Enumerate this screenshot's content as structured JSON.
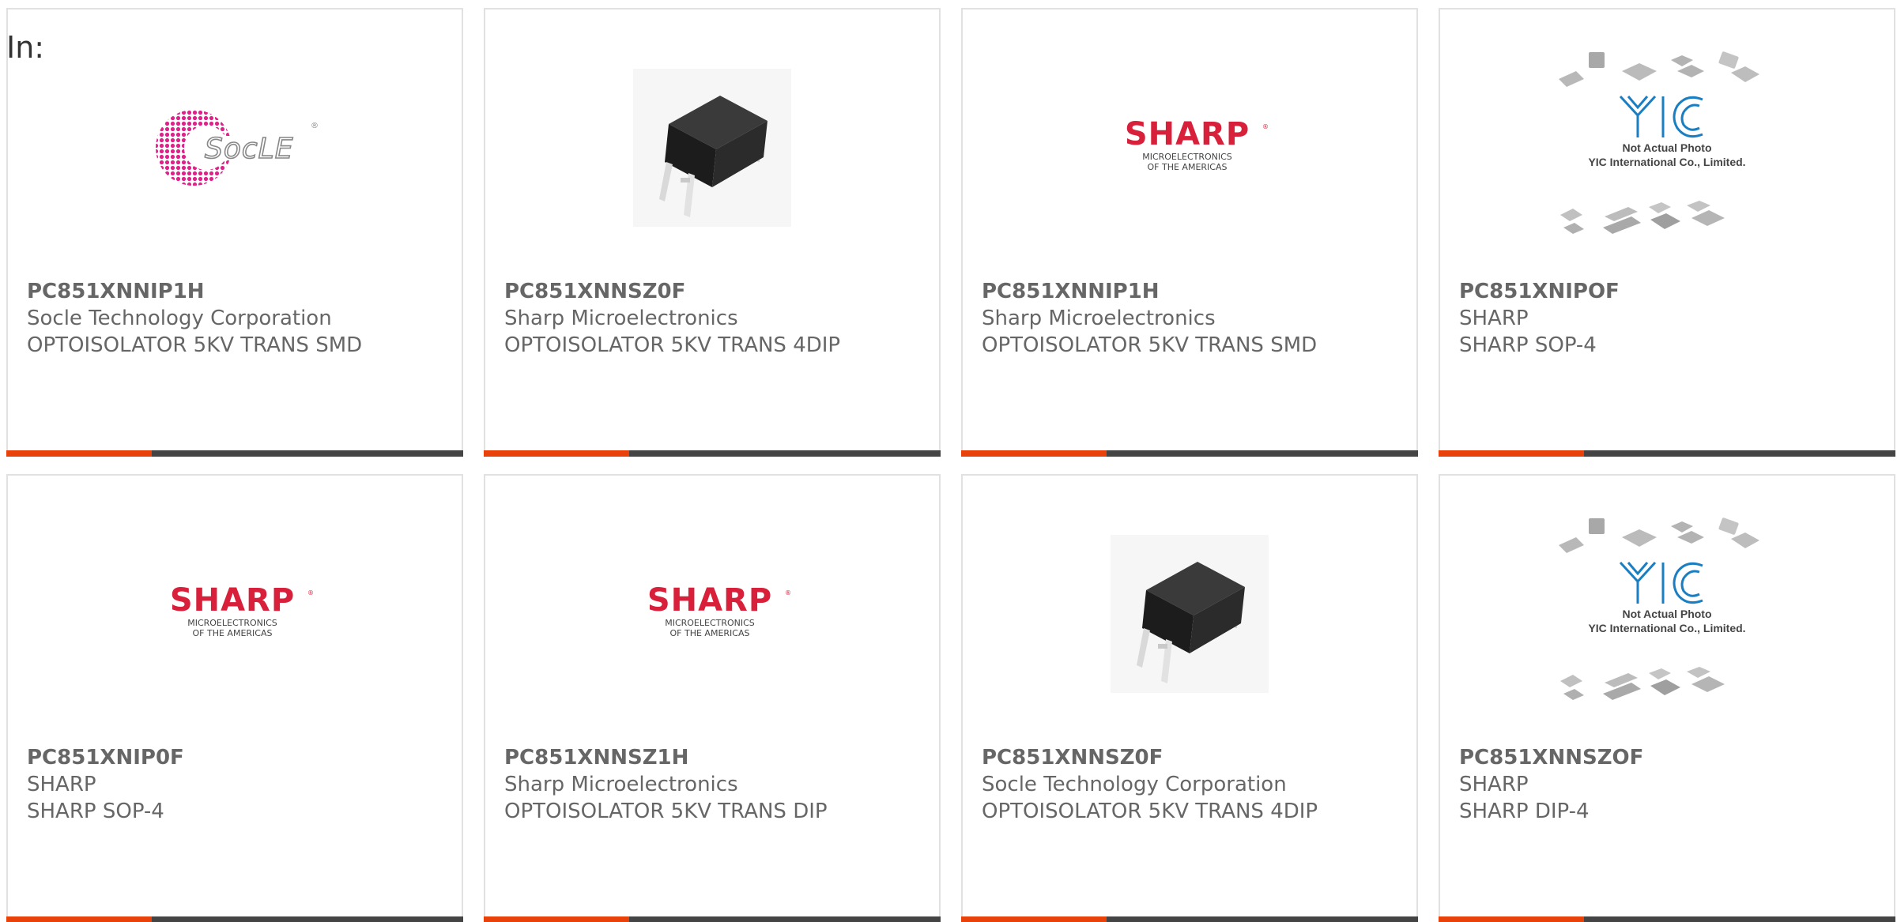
{
  "heading": "In:",
  "products": [
    {
      "part": "PC851XNNIP1H",
      "manufacturer": "Socle Technology Corporation",
      "description": "OPTOISOLATOR 5KV TRANS SMD",
      "image": "socle-logo"
    },
    {
      "part": "PC851XNNSZ0F",
      "manufacturer": "Sharp Microelectronics",
      "description": "OPTOISOLATOR 5KV TRANS 4DIP",
      "image": "dip-chip"
    },
    {
      "part": "PC851XNNIP1H",
      "manufacturer": "Sharp Microelectronics",
      "description": "OPTOISOLATOR 5KV TRANS SMD",
      "image": "sharp-logo"
    },
    {
      "part": "PC851XNIPOF",
      "manufacturer": "SHARP",
      "description": "SHARP SOP-4",
      "image": "yic-placeholder"
    },
    {
      "part": "PC851XNIP0F",
      "manufacturer": "SHARP",
      "description": "SHARP SOP-4",
      "image": "sharp-logo"
    },
    {
      "part": "PC851XNNSZ1H",
      "manufacturer": "Sharp Microelectronics",
      "description": "OPTOISOLATOR 5KV TRANS DIP",
      "image": "sharp-logo"
    },
    {
      "part": "PC851XNNSZ0F",
      "manufacturer": "Socle Technology Corporation",
      "description": "OPTOISOLATOR 5KV TRANS 4DIP",
      "image": "dip-chip"
    },
    {
      "part": "PC851XNNSZOF",
      "manufacturer": "SHARP",
      "description": "SHARP DIP-4",
      "image": "yic-placeholder"
    }
  ],
  "logos": {
    "socle": {
      "text": "SocLE",
      "mark": "®"
    },
    "sharp": {
      "text": "SHARP",
      "mark": "®",
      "tagline1": "MICROELECTRONICS",
      "tagline2": "OF THE AMERICAS"
    },
    "yic": {
      "text": "YIC",
      "line1": "Not Actual Photo",
      "line2": "YIC International Co., Limited."
    }
  },
  "colors": {
    "accent": "#e8410a",
    "bar": "#444444",
    "sharp_red": "#d8203a",
    "socle_pink": "#e0218a",
    "yic_blue": "#1a7ec2",
    "text": "#666666"
  }
}
